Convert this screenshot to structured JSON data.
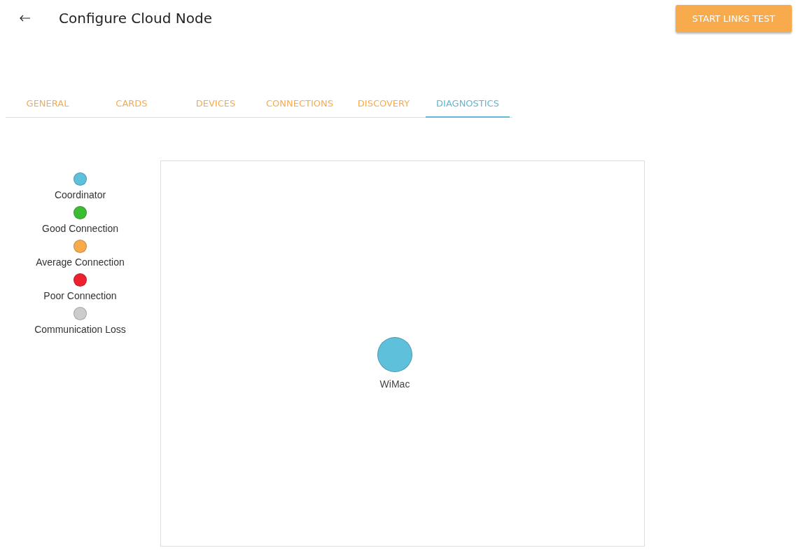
{
  "header": {
    "title": "Configure Cloud Node",
    "action_button": "START LINKS TEST"
  },
  "tabs": [
    {
      "label": "GENERAL",
      "selected": false
    },
    {
      "label": "CARDS",
      "selected": false
    },
    {
      "label": "DEVICES",
      "selected": false
    },
    {
      "label": "CONNECTIONS",
      "selected": false
    },
    {
      "label": "DISCOVERY",
      "selected": false
    },
    {
      "label": "DIAGNOSTICS",
      "selected": true
    }
  ],
  "legend": [
    {
      "label": "Coordinator",
      "color": "#5fc0dc"
    },
    {
      "label": "Good Connection",
      "color": "#3cbc32"
    },
    {
      "label": "Average Connection",
      "color": "#f8ab4c"
    },
    {
      "label": "Poor Connection",
      "color": "#ec2130"
    },
    {
      "label": "Communication Loss",
      "color": "#cccccc"
    }
  ],
  "network": {
    "nodes": [
      {
        "label": "WiMac",
        "color": "#5fc0dc"
      }
    ]
  }
}
